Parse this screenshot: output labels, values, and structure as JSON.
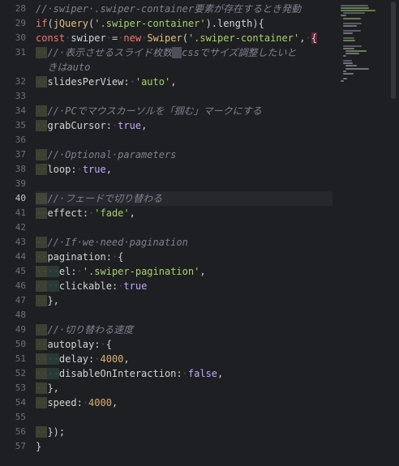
{
  "editor": {
    "active_line": 40,
    "lines": [
      {
        "n": 28,
        "text": "//·swiper·.swiper-container要素が存在するとき発動"
      },
      {
        "n": 29,
        "text": "if(jQuery('.swiper-container').length){"
      },
      {
        "n": 30,
        "text": "const·swiper·=·new·Swiper('.swiper-container',·{"
      },
      {
        "n": 31,
        "text": "··//·表示させるスライド枚数　cssでサイズ調整したいと"
      },
      {
        "n": "",
        "text": "  きはauto"
      },
      {
        "n": 32,
        "text": "··slidesPerView:·'auto',"
      },
      {
        "n": 33,
        "text": ""
      },
      {
        "n": 34,
        "text": "··//·PCでマウスカーソルを「掴む」マークにする"
      },
      {
        "n": 35,
        "text": "··grabCursor:·true,"
      },
      {
        "n": 36,
        "text": ""
      },
      {
        "n": 37,
        "text": "··//·Optional·parameters"
      },
      {
        "n": 38,
        "text": "··loop:·true,"
      },
      {
        "n": 39,
        "text": ""
      },
      {
        "n": 40,
        "text": "··//·フェードで切り替わる"
      },
      {
        "n": 41,
        "text": "··effect:·'fade',"
      },
      {
        "n": 42,
        "text": ""
      },
      {
        "n": 43,
        "text": "··//·If·we·need·pagination"
      },
      {
        "n": 44,
        "text": "··pagination:·{"
      },
      {
        "n": 45,
        "text": "····el:·'.swiper-pagination',"
      },
      {
        "n": 46,
        "text": "····clickable:·true"
      },
      {
        "n": 47,
        "text": "··},"
      },
      {
        "n": 48,
        "text": ""
      },
      {
        "n": 49,
        "text": "··//·切り替わる速度"
      },
      {
        "n": 50,
        "text": "··autoplay:·{"
      },
      {
        "n": 51,
        "text": "····delay:·4000,"
      },
      {
        "n": 52,
        "text": "····disableOnInteraction:·false,"
      },
      {
        "n": 53,
        "text": "··},"
      },
      {
        "n": 54,
        "text": "··speed:·4000,"
      },
      {
        "n": 55,
        "text": ""
      },
      {
        "n": 56,
        "text": "··});"
      },
      {
        "n": 57,
        "text": "}"
      }
    ]
  },
  "colors": {
    "background": "#1e1f22",
    "comment": "#7b828f",
    "keyword": "#f5766d",
    "function": "#e5c07b",
    "string": "#a6d36a",
    "boolean": "#c3a6ff",
    "number": "#d7b070",
    "active_line": "#26282d"
  }
}
